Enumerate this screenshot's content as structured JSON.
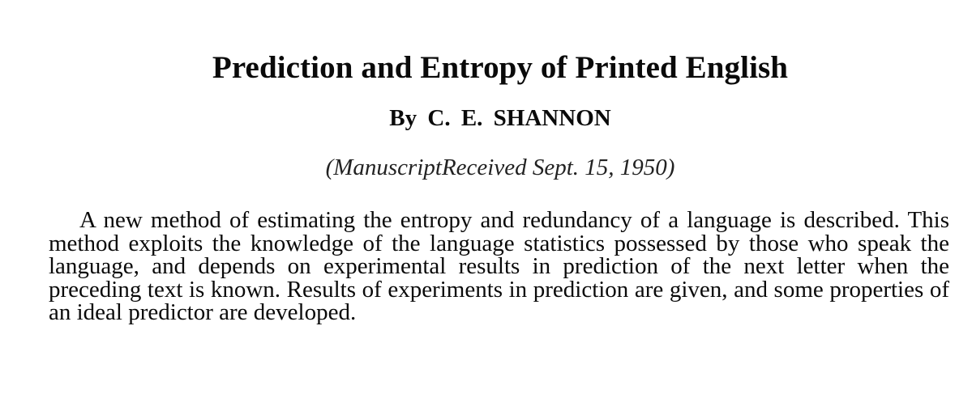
{
  "paper": {
    "title": "Prediction and Entropy of Printed English",
    "author": "By C. E. SHANNON",
    "received": "(ManuscriptReceived Sept. 15, 1950)",
    "abstract": "A new method of estimating the entropy and redundancy of a language is described. This method exploits the knowledge of the language statistics possessed by those who speak the language, and depends on experimental results in prediction of the next letter when the preceding text is known. Results of experiments in prediction are given, and some properties of an ideal predictor are developed."
  }
}
